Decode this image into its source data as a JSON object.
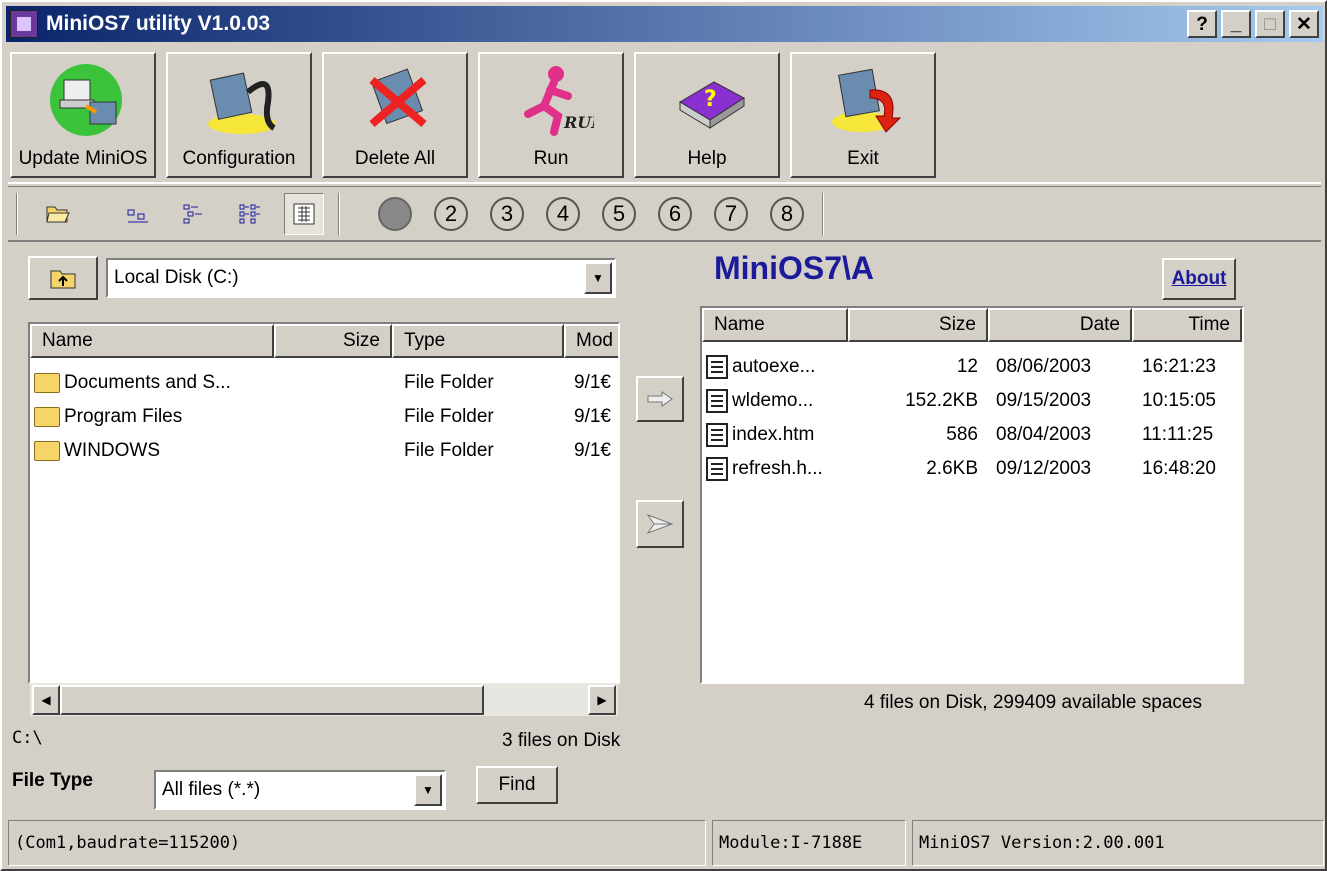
{
  "window": {
    "title": "MiniOS7 utility V1.0.03",
    "help_btn": "?",
    "min_btn": "_",
    "max_btn": "□",
    "close_btn": "✕"
  },
  "toolbar": {
    "buttons": [
      {
        "label": "Update MiniOS",
        "icon": "update-minios-icon"
      },
      {
        "label": "Configuration",
        "icon": "configuration-icon"
      },
      {
        "label": "Delete All",
        "icon": "delete-all-icon"
      },
      {
        "label": "Run",
        "icon": "run-icon"
      },
      {
        "label": "Help",
        "icon": "help-book-icon"
      },
      {
        "label": "Exit",
        "icon": "exit-icon"
      }
    ]
  },
  "smallbar": {
    "view_icons": [
      "open-folder-icon",
      "small-icons-view-icon",
      "list-view-icon",
      "details-view-icon",
      "report-view-icon"
    ],
    "com_ports": [
      "1",
      "2",
      "3",
      "4",
      "5",
      "6",
      "7",
      "8"
    ]
  },
  "left": {
    "drive": "Local Disk (C:)",
    "headers": {
      "name": "Name",
      "size": "Size",
      "type": "Type",
      "modified": "Mod"
    },
    "rows": [
      {
        "name": "Documents and S...",
        "size": "",
        "type": "File Folder",
        "modified": "9/1€"
      },
      {
        "name": "Program Files",
        "size": "",
        "type": "File Folder",
        "modified": "9/1€"
      },
      {
        "name": "WINDOWS",
        "size": "",
        "type": "File Folder",
        "modified": "9/1€"
      }
    ],
    "path": "C:\\",
    "file_count": "3 files on Disk"
  },
  "file_type": {
    "label": "File Type",
    "value": "All files (*.*)",
    "find_label": "Find"
  },
  "transfer": {
    "copy_icon": "copy-arrow-icon",
    "send_icon": "send-plane-icon"
  },
  "right": {
    "title": "MiniOS7\\A",
    "about_label": "About",
    "headers": {
      "name": "Name",
      "size": "Size",
      "date": "Date",
      "time": "Time"
    },
    "rows": [
      {
        "name": "autoexe...",
        "size": "12",
        "date": "08/06/2003",
        "time": "16:21:23"
      },
      {
        "name": "wldemo...",
        "size": "152.2KB",
        "date": "09/15/2003",
        "time": "10:15:05"
      },
      {
        "name": "index.htm",
        "size": "586",
        "date": "08/04/2003",
        "time": "11:11:25"
      },
      {
        "name": "refresh.h...",
        "size": "2.6KB",
        "date": "09/12/2003",
        "time": "16:48:20"
      }
    ],
    "disk_info": "4 files on Disk,  299409 available spaces"
  },
  "status": {
    "com": "(Com1,baudrate=115200)",
    "module": "Module:I-7188E",
    "version": "MiniOS7 Version:2.00.001"
  }
}
